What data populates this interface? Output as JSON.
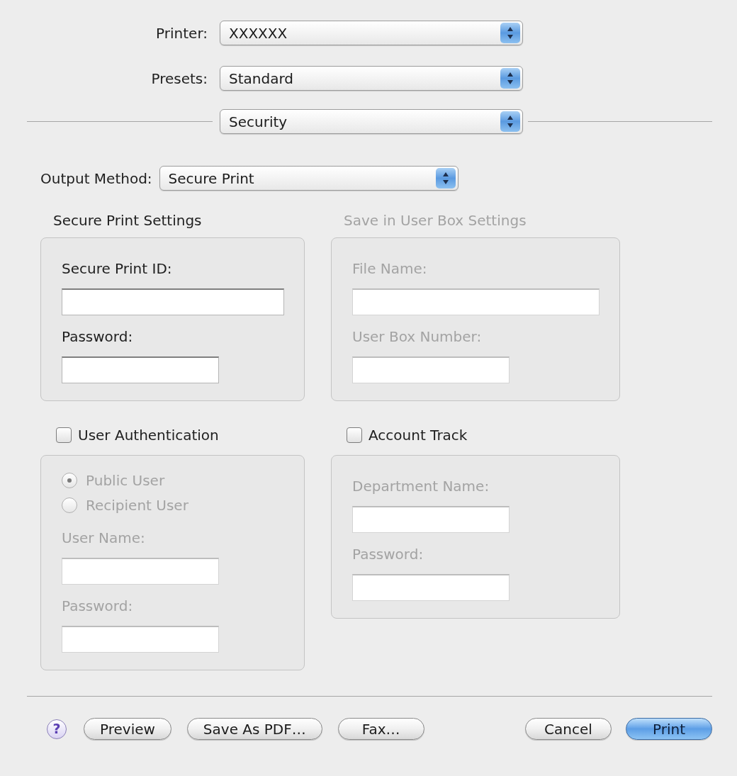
{
  "printer_settings": [
    {
      "label": "Printer:",
      "value": "XXXXXX"
    },
    {
      "label": "Presets:",
      "value": "Standard"
    }
  ],
  "pane_popup": {
    "value": "Security"
  },
  "output_method": {
    "label": "Output Method:",
    "value": "Secure Print"
  },
  "groups": [
    {
      "kind": "titled",
      "title": "Secure Print Settings",
      "disabled": false,
      "fields": [
        {
          "label": "Secure Print ID:"
        },
        {
          "label": "Password:"
        }
      ]
    },
    {
      "kind": "titled",
      "title": "Save in User Box Settings",
      "disabled": true,
      "fields": [
        {
          "label": "File Name:"
        },
        {
          "label": "User Box Number:"
        }
      ]
    },
    {
      "kind": "checkbox",
      "title": "User Authentication",
      "checked": false,
      "disabled": true,
      "options": [
        {
          "label": "Public User",
          "selected": true
        },
        {
          "label": "Recipient User",
          "selected": false
        }
      ],
      "fields": [
        {
          "label": "User Name:"
        },
        {
          "label": "Password:"
        }
      ]
    },
    {
      "kind": "checkbox",
      "title": "Account Track",
      "checked": false,
      "disabled": true,
      "fields": [
        {
          "label": "Department Name:"
        },
        {
          "label": "Password:"
        }
      ]
    }
  ],
  "help_button": {
    "label": "?"
  },
  "left_buttons": [
    {
      "label": "Preview",
      "kind": "push"
    },
    {
      "label": "Save As PDF…",
      "kind": "push"
    },
    {
      "label": "Fax…",
      "kind": "push"
    }
  ],
  "right_buttons": [
    {
      "label": "Cancel",
      "kind": "push"
    },
    {
      "label": "Print",
      "kind": "default"
    }
  ]
}
